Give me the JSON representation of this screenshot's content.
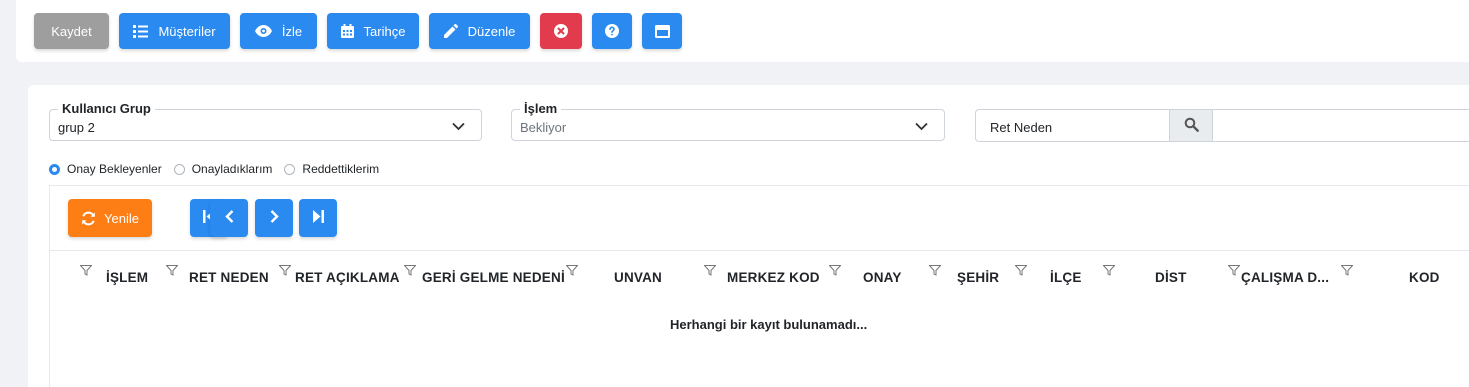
{
  "toolbar": {
    "save": "Kaydet",
    "customers": "Müşteriler",
    "watch": "İzle",
    "history": "Tarihçe",
    "edit": "Düzenle"
  },
  "filters": {
    "group": {
      "label": "Kullanıcı Grup",
      "value": "grup 2"
    },
    "process": {
      "label": "İşlem",
      "value": "Bekliyor"
    },
    "reject_reason": {
      "label": "Ret Neden"
    }
  },
  "radios": [
    {
      "label": "Onay Bekleyenler",
      "checked": true
    },
    {
      "label": "Onayladıklarım",
      "checked": false
    },
    {
      "label": "Reddettiklerim",
      "checked": false
    }
  ],
  "pager": {
    "refresh": "Yenile"
  },
  "columns": [
    "İŞLEM",
    "RET NEDEN",
    "RET AÇIKLAMA",
    "GERİ GELME NEDENİ",
    "UNVAN",
    "MERKEZ KOD",
    "ONAY",
    "ŞEHİR",
    "İLÇE",
    "DİST",
    "ÇALIŞMA D...",
    "KOD"
  ],
  "empty_message": "Herhangi bir kayıt bulunamadı...",
  "colors": {
    "primary": "#2a8af0",
    "danger": "#e23b4d",
    "warning": "#fd7e14",
    "disabled": "#9e9e9e"
  }
}
